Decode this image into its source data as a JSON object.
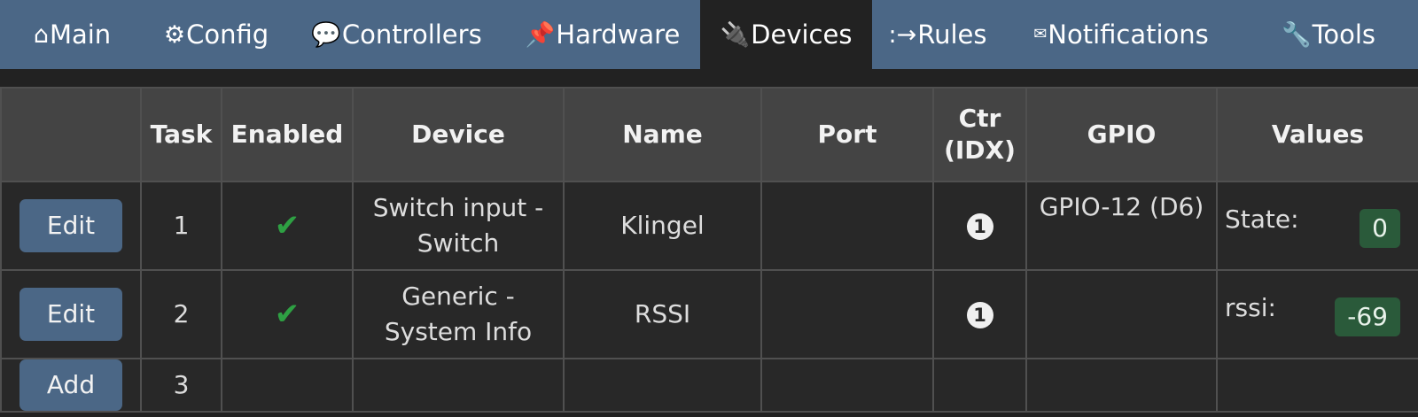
{
  "nav": {
    "tabs": [
      {
        "icon": "⌂",
        "icon_name": "home-icon",
        "label": "Main",
        "active": false
      },
      {
        "icon": "⚙",
        "icon_name": "gear-icon",
        "label": "Config",
        "active": false
      },
      {
        "icon": "💬",
        "icon_name": "speech-bubble-icon",
        "label": "Controllers",
        "active": false
      },
      {
        "icon": "📌",
        "icon_name": "pushpin-icon",
        "label": "Hardware",
        "active": false
      },
      {
        "icon": "🔌",
        "icon_name": "plug-icon",
        "label": "Devices",
        "active": true
      },
      {
        "icon": ":→",
        "icon_name": "rules-arrow-icon",
        "label": "Rules",
        "active": false
      },
      {
        "icon": "✉",
        "icon_name": "envelope-icon",
        "label": "Notifications",
        "active": false
      },
      {
        "icon": "🔧",
        "icon_name": "wrench-icon",
        "label": "Tools",
        "active": false
      }
    ]
  },
  "table": {
    "headers": {
      "action": "",
      "task": "Task",
      "enabled": "Enabled",
      "device": "Device",
      "name": "Name",
      "port": "Port",
      "ctr_line1": "Ctr",
      "ctr_line2": "(IDX)",
      "gpio": "GPIO",
      "values": "Values"
    },
    "rows": [
      {
        "button": "Edit",
        "task": "1",
        "enabled": "✔",
        "device_line1": "Switch input -",
        "device_line2": "Switch",
        "name": "Klingel",
        "port": "",
        "ctr": "1",
        "gpio": "GPIO-12 (D6)",
        "value_label": "State:",
        "value": "0"
      },
      {
        "button": "Edit",
        "task": "2",
        "enabled": "✔",
        "device_line1": "Generic -",
        "device_line2": "System Info",
        "name": "RSSI",
        "port": "",
        "ctr": "1",
        "gpio": "",
        "value_label": "rssi:",
        "value": "-69"
      },
      {
        "button": "Add",
        "task": "3"
      }
    ]
  },
  "colors": {
    "nav_bg": "#4b6786",
    "active_tab_bg": "#222222",
    "header_bg": "#444444",
    "cell_bg": "#282828",
    "button_bg": "#4b6786",
    "check": "#2ea043",
    "value_badge_bg": "#2a5a3a"
  }
}
